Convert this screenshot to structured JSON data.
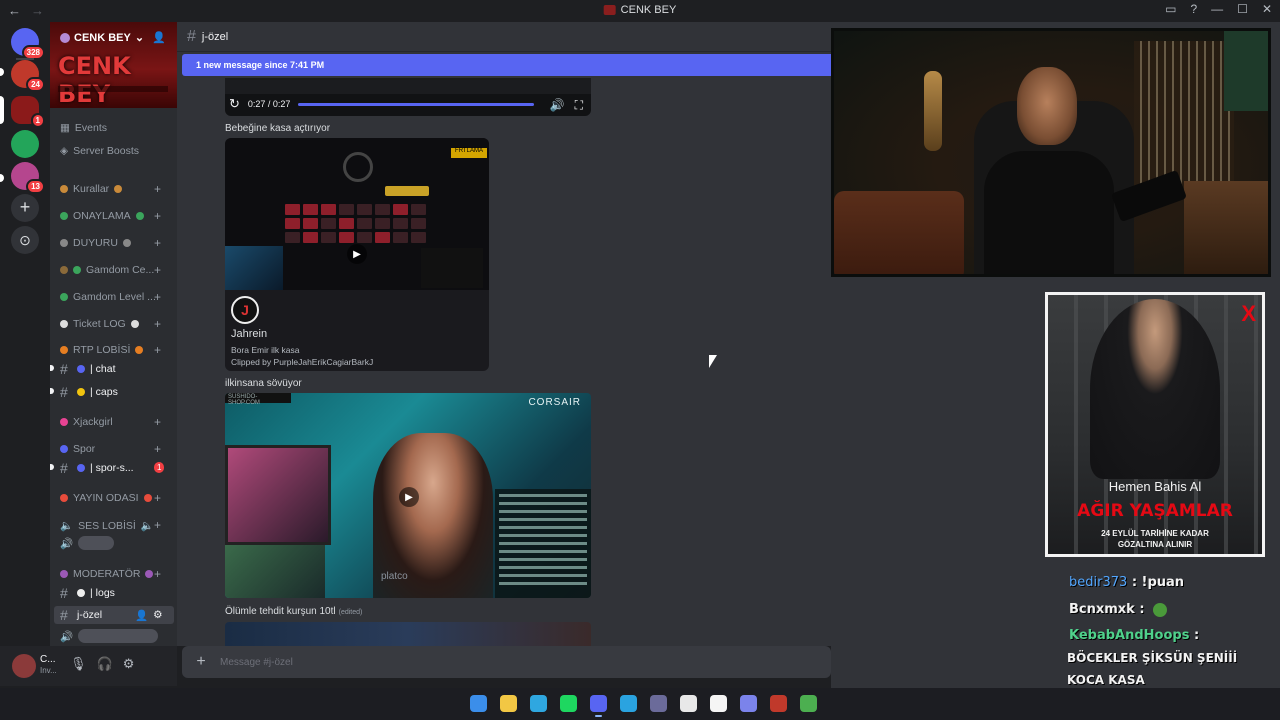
{
  "window": {
    "title": "CENK BEY",
    "nav_back": "←",
    "nav_forward": "→"
  },
  "server_rail": {
    "items": [
      {
        "name": "home",
        "badge": "328",
        "color": "#5865f2"
      },
      {
        "name": "server-a",
        "badge": "24",
        "color": "#c0392b"
      },
      {
        "name": "cenk-bey",
        "badge": "1",
        "color": "#8b1a1a"
      },
      {
        "name": "green-server",
        "badge": "",
        "color": "#23a55a"
      },
      {
        "name": "chiru-server",
        "badge": "13",
        "color": "#b5468e"
      }
    ],
    "add_label": "+",
    "explore_label": "⊙"
  },
  "server": {
    "name": "CENK BEY",
    "banner_text": "CENK BEY",
    "top_items": [
      {
        "label": "Events",
        "icon": "calendar-icon"
      },
      {
        "label": "Server Boosts",
        "icon": "boost-icon"
      }
    ],
    "categories": [
      {
        "label": "Kurallar"
      },
      {
        "label": "ONAYLAMA"
      },
      {
        "label": "DUYURU"
      },
      {
        "label": "Gamdom Ce..."
      },
      {
        "label": "Gamdom Level ..."
      },
      {
        "label": "Ticket LOG"
      },
      {
        "label": "RTP LOBİSİ"
      },
      {
        "label": "Xjackgirl"
      },
      {
        "label": "Spor"
      },
      {
        "label": "YAYIN ODASI"
      },
      {
        "label": "SES LOBİSİ"
      },
      {
        "label": "MODERATÖR"
      }
    ],
    "channels": {
      "chat": "| chat",
      "caps": "| caps",
      "spor": "| spor-s...",
      "spor_badge": "1",
      "logs": "| logs",
      "jozel": "j-özel"
    }
  },
  "user_panel": {
    "name": "C...",
    "status": "Inv..."
  },
  "channel": {
    "name": "j-özel",
    "new_message_banner": "1 new message since 7:41 PM",
    "input_placeholder": "Message #j-özel"
  },
  "messages": [
    {
      "kind": "audio",
      "time": "0:27 / 0:27"
    },
    {
      "text": "Bebeğine kasa açtırıyor",
      "embed": {
        "author": "Jahrein",
        "desc1": "Bora Emir ilk kasa",
        "desc2": "Clipped by PurpleJahErikCagiarBarkJ",
        "logo": "FRTLAMA"
      }
    },
    {
      "text": "ilkinsana sövüyor",
      "embed": {
        "site": "SUSHIDO-SHOP.COM",
        "brand": "CORSAIR",
        "watermark": "platco"
      }
    },
    {
      "text": "Ölümle tehdit kurşun 10tl",
      "edited": "(edited)"
    }
  ],
  "overlay": {
    "ad": {
      "line1": "Hemen Bahis Al",
      "line2": "AĞIR YAŞAMLAR",
      "line3": "24 EYLÜL TARİHİNE KADAR",
      "line4": "GÖZALTINA ALINIR",
      "corner": "X"
    },
    "chat": [
      {
        "user": "bedir373",
        "text": ": !puan"
      },
      {
        "user": "Bcnxmxk",
        "text": ":"
      },
      {
        "user": "KebabAndHoops",
        "text": ":"
      }
    ],
    "big_message_1": "BÖCEKLER ŞİKSÜN ŞENİİİ",
    "big_message_2": "KOCA KASA"
  },
  "taskbar": {
    "icons": [
      "windows-start-icon",
      "file-explorer-icon",
      "edge-icon",
      "spotify-icon",
      "discord-icon",
      "telegram-icon",
      "ai-icon",
      "chrome-icon",
      "notion-icon",
      "teams-icon",
      "voicemeeter-icon",
      "minecraft-icon"
    ],
    "colors": [
      "#3b8eea",
      "#f2c744",
      "#2fa7e0",
      "#1ed760",
      "#5865f2",
      "#2aa3e0",
      "#6b6b9a",
      "#e8e8e8",
      "#f5f5f5",
      "#7b83eb",
      "#c0392b",
      "#4caf50"
    ]
  }
}
